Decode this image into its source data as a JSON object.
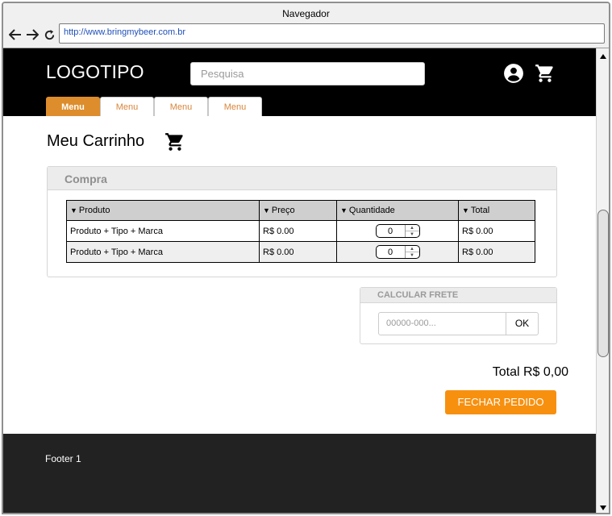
{
  "browser": {
    "window_title": "Navegador",
    "url": "http://www.bringmybeer.com.br",
    "back_glyph": "🡐",
    "forward_glyph": "🡒",
    "reload_glyph": "⟳"
  },
  "header": {
    "logo": "LOGOTIPO",
    "search_placeholder": "Pesquisa",
    "icons": [
      "user-circle-icon",
      "cart-icon"
    ],
    "tabs": [
      {
        "label": "Menu",
        "active": true
      },
      {
        "label": "Menu",
        "active": false
      },
      {
        "label": "Menu",
        "active": false
      },
      {
        "label": "Menu",
        "active": false
      }
    ]
  },
  "page": {
    "title": "Meu Carrinho"
  },
  "cart_panel": {
    "title": "Compra",
    "columns": [
      "Produto",
      "Preço",
      "Quantidade",
      "Total"
    ],
    "rows": [
      {
        "product": "Produto + Tipo + Marca",
        "price": "R$ 0.00",
        "quantity": "0",
        "total": "R$ 0.00"
      },
      {
        "product": "Produto + Tipo + Marca",
        "price": "R$ 0.00",
        "quantity": "0",
        "total": "R$ 0.00"
      }
    ]
  },
  "shipping": {
    "title": "CALCULAR FRETE",
    "cep_placeholder": "00000-000...",
    "ok_label": "OK"
  },
  "summary": {
    "total": "Total R$ 0,00",
    "checkout_label": "FECHAR PEDIDO"
  },
  "footer": {
    "text": "Footer 1"
  },
  "colors": {
    "header_bg": "#000000",
    "accent_tab": "#dd8d2c",
    "checkout_button": "#f7900f",
    "footer_bg": "#222222",
    "link_blue": "#1f4fb8"
  }
}
